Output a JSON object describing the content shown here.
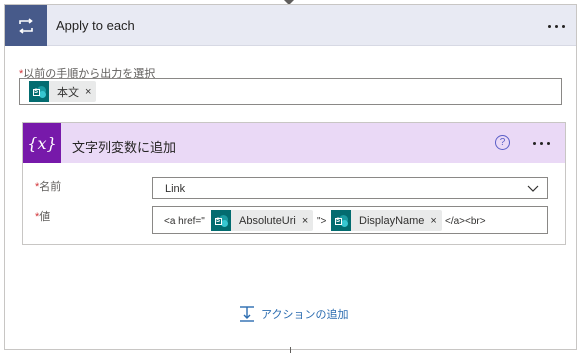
{
  "loop": {
    "title": "Apply to each",
    "icon": "loop-icon",
    "select_label": "以前の手順から出力を選択",
    "required_mark": "*",
    "select_token": {
      "text": "本文",
      "icon": "sharepoint-icon"
    }
  },
  "action": {
    "title": "文字列変数に追加",
    "icon": "variable-icon",
    "icon_glyph": "{x}",
    "help_glyph": "?",
    "name_label": "名前",
    "name_value": "Link",
    "value_label": "値",
    "value_parts": {
      "prefix": "<a href=\"",
      "token1": "AbsoluteUri",
      "middle": "\">",
      "token2": "DisplayName",
      "suffix": "</a><br>"
    }
  },
  "add_action": {
    "label": "アクションの追加",
    "icon": "add-action-icon"
  },
  "close_glyph": "×",
  "colors": {
    "loop_header_bg": "#e8eaf3",
    "loop_icon_bg": "#475a8a",
    "variable_header_bg": "#ead9f6",
    "variable_icon_bg": "#7719aa",
    "sharepoint_teal": "#036c70",
    "link": "#2b6cb0",
    "required": "#d13438"
  }
}
